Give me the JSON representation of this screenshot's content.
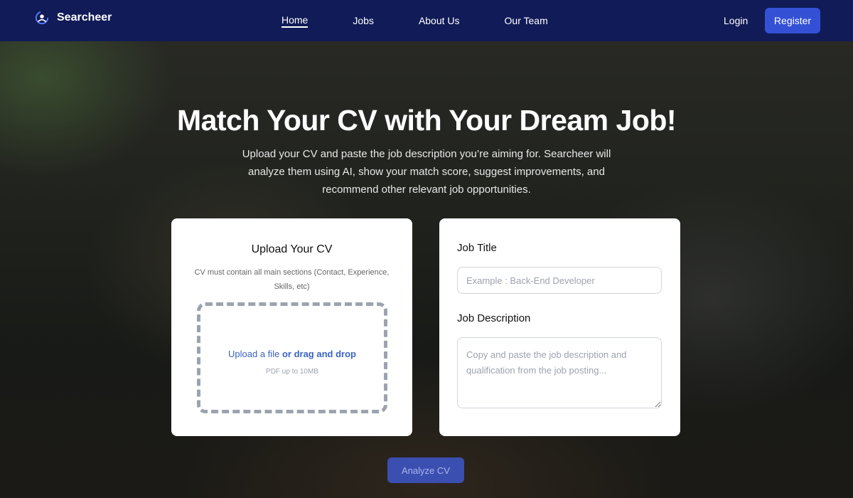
{
  "nav": {
    "brand": "Searcheer",
    "links": [
      "Home",
      "Jobs",
      "About Us",
      "Our Team"
    ],
    "login": "Login",
    "register": "Register"
  },
  "hero": {
    "title": "Match Your CV with Your Dream Job!",
    "subtitle": "Upload your CV and paste the job description you’re aiming for. Searcheer will analyze them using AI, show your match score, suggest improvements, and recommend other relevant job opportunities."
  },
  "upload_card": {
    "title": "Upload Your CV",
    "note": "CV must contain all main sections (Contact, Experience, Skills, etc)",
    "upload_link": "Upload a file",
    "drag_text": "or drag and drop",
    "hint": "PDF up to 10MB"
  },
  "job_card": {
    "title_label": "Job Title",
    "title_placeholder": "Example : Back-End Developer",
    "desc_label": "Job Description",
    "desc_placeholder": "Copy and paste the job description and qualification from the job posting..."
  },
  "analyze_button": "Analyze CV",
  "colors": {
    "navbar": "#101b57",
    "accent": "#3451d6",
    "link": "#3a63c4"
  }
}
